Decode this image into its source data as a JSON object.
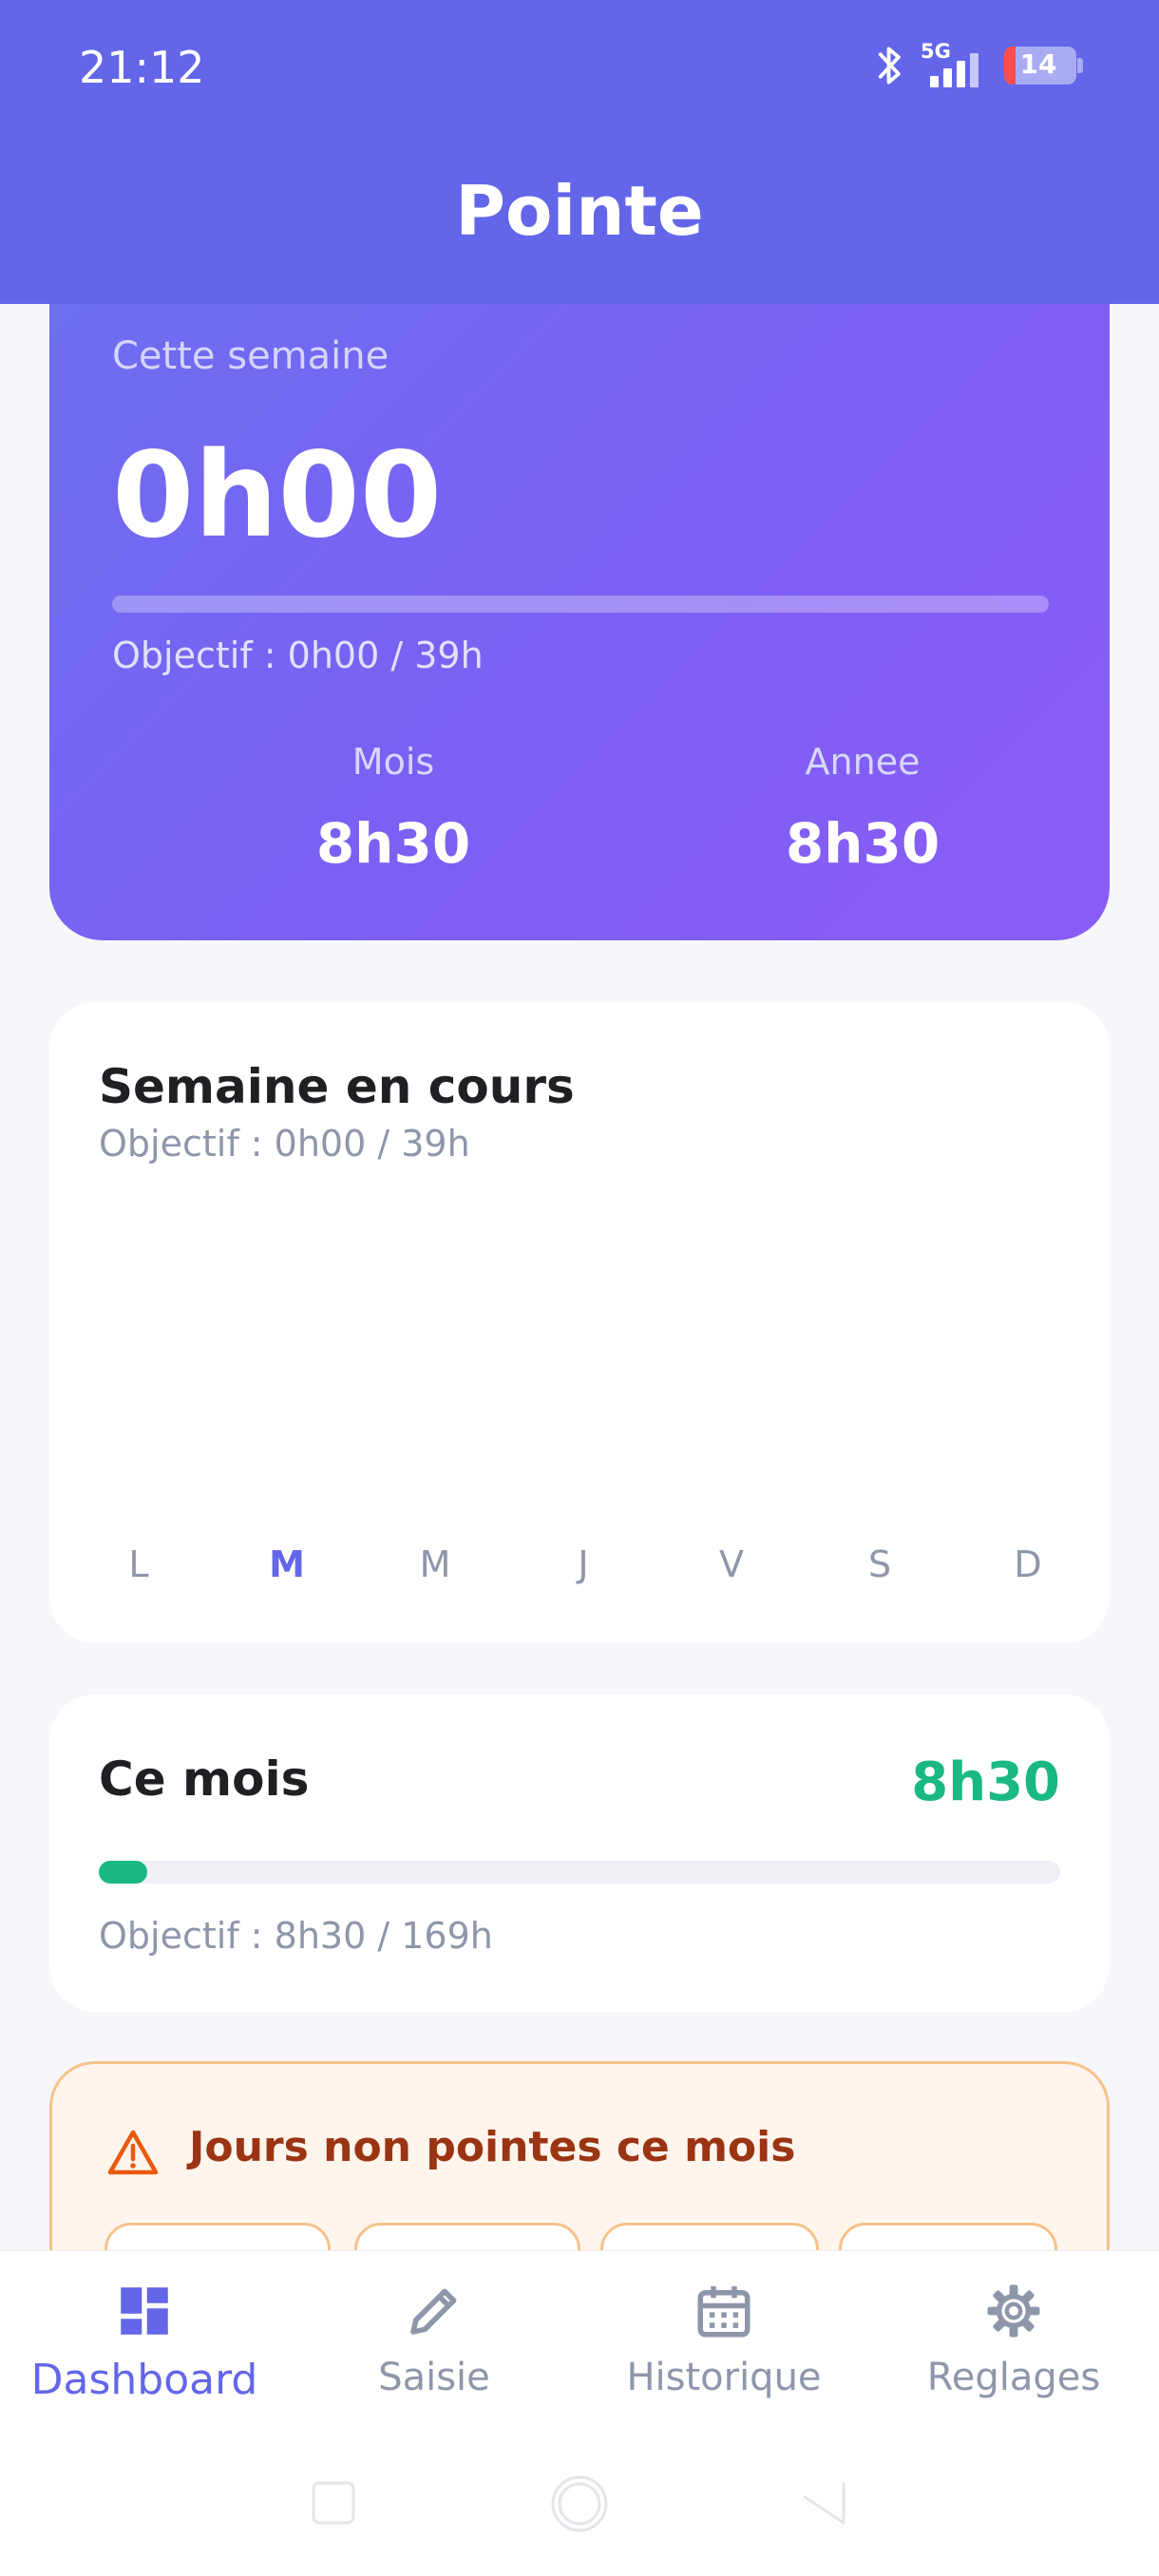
{
  "status_bar": {
    "time": "21:12",
    "network": "5G",
    "battery": "14"
  },
  "app": {
    "title": "Pointe"
  },
  "summary": {
    "label": "Cette semaine",
    "value": "0h00",
    "progress": 0,
    "goal": "Objectif : 0h00 / 39h",
    "month_label": "Mois",
    "month_value": "8h30",
    "year_label": "Annee",
    "year_value": "8h30"
  },
  "week": {
    "title": "Semaine en cours",
    "goal": "Objectif : 0h00 / 39h",
    "days": [
      "L",
      "M",
      "M",
      "J",
      "V",
      "S",
      "D"
    ],
    "active_day_index": 1
  },
  "month": {
    "title": "Ce mois",
    "total": "8h30",
    "progress": 0.05,
    "goal": "Objectif : 8h30 / 169h"
  },
  "warning": {
    "title": "Jours non pointes ce mois"
  },
  "nav": {
    "items": [
      {
        "label": "Dashboard",
        "icon": "dashboard-icon"
      },
      {
        "label": "Saisie",
        "icon": "pencil-icon"
      },
      {
        "label": "Historique",
        "icon": "calendar-icon"
      },
      {
        "label": "Reglages",
        "icon": "gear-icon"
      }
    ],
    "active_index": 0
  },
  "colors": {
    "primary": "#6366e9",
    "success": "#19b981",
    "warning_text": "#9a3412",
    "warning_border": "#f7c28a"
  }
}
